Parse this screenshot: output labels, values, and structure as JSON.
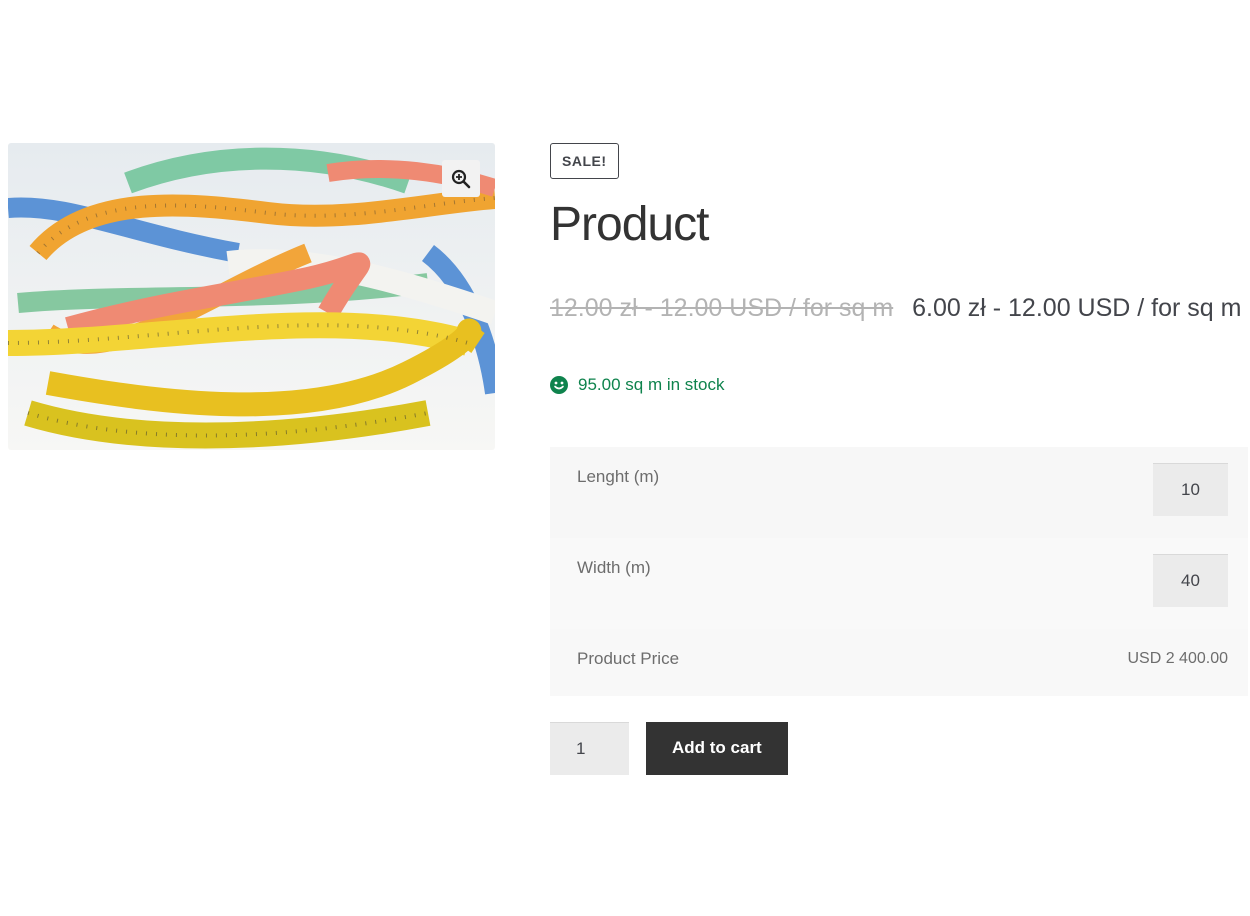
{
  "gallery": {
    "image_alt": "measuring tapes",
    "zoom_icon": "zoom-in-icon"
  },
  "product": {
    "badge": "SALE!",
    "title": "Product",
    "price_regular": "12.00 zł - 12.00 USD / for sq m",
    "price_sale": "6.00 zł - 12.00 USD / for sq m",
    "stock_icon": "smiley-icon",
    "stock_text": "95.00 sq m in stock"
  },
  "measurements": {
    "length_label": "Lenght (m)",
    "length_value": "10",
    "width_label": "Width (m)",
    "width_value": "40",
    "price_label": "Product Price",
    "price_value": "USD 2 400.00"
  },
  "cart": {
    "quantity": "1",
    "add_label": "Add to cart"
  },
  "colors": {
    "stock_green": "#0f834d",
    "button_dark": "#333333",
    "strike_gray": "#b3b3b3"
  }
}
